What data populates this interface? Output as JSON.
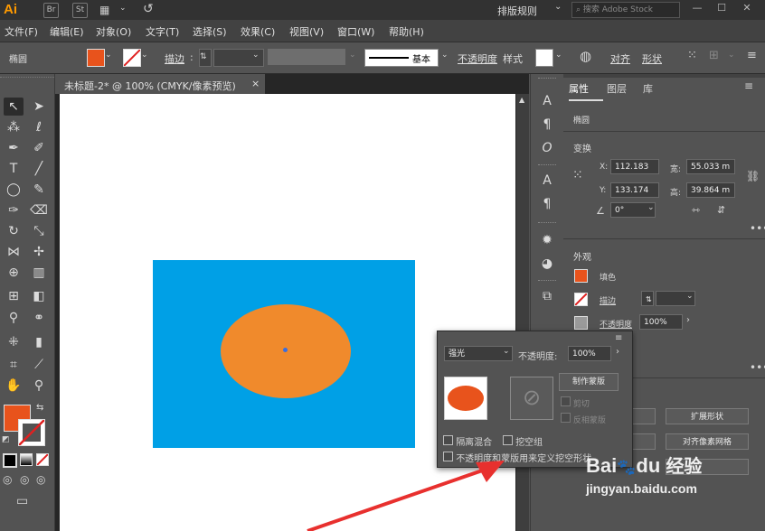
{
  "app": {
    "logo": "Ai",
    "br": "Br",
    "st": "St",
    "workspace": "排版规则",
    "stock_search_placeholder": "搜索 Adobe Stock"
  },
  "menu": [
    "文件(F)",
    "编辑(E)",
    "对象(O)",
    "文字(T)",
    "选择(S)",
    "效果(C)",
    "视图(V)",
    "窗口(W)",
    "帮助(H)"
  ],
  "control_bar": {
    "object_type": "椭圆",
    "stroke_label": "描边",
    "stroke_style": "基本",
    "opacity_label": "不透明度",
    "style_label": "样式",
    "align_label": "对齐",
    "shape_label": "形状"
  },
  "document": {
    "tab_title": "未标题-2* @ 100% (CMYK/像素预览)",
    "close_glyph": "×"
  },
  "properties": {
    "tabs": [
      "属性",
      "图层",
      "库"
    ],
    "object_type": "椭圆",
    "transform_title": "变换",
    "x_label": "X:",
    "x_value": "112.183",
    "y_label": "Y:",
    "y_value": "133.174",
    "w_label": "宽:",
    "w_value": "55.033 m",
    "h_label": "高:",
    "h_value": "39.864 m",
    "angle_value": "0°",
    "appearance_title": "外观",
    "fill_label": "填色",
    "stroke_label": "描边",
    "opacity_label": "不透明度",
    "opacity_value": "100%",
    "expand_shape_btn": "扩展形状",
    "align_pixel_btn": "对齐像素网格"
  },
  "transparency_panel": {
    "blend_mode": "强光",
    "opacity_label": "不透明度:",
    "opacity_value": "100%",
    "make_mask_btn": "制作蒙版",
    "clip_label": "剪切",
    "invert_mask_label": "反相蒙版",
    "isolate_blending_label": "隔离混合",
    "knockout_group_label": "挖空组",
    "opacity_mask_knockout_label": "不透明度和蒙版用来定义挖空形状"
  },
  "watermark": {
    "brand": "Bai",
    "paw": "du",
    "site_cn": "经验",
    "url": "jingyan.baidu.com"
  },
  "colors": {
    "fill": "#e8531c",
    "blue_rect": "#00a0e6",
    "ellipse": "#f08a2c",
    "arrow": "#e8302e"
  }
}
